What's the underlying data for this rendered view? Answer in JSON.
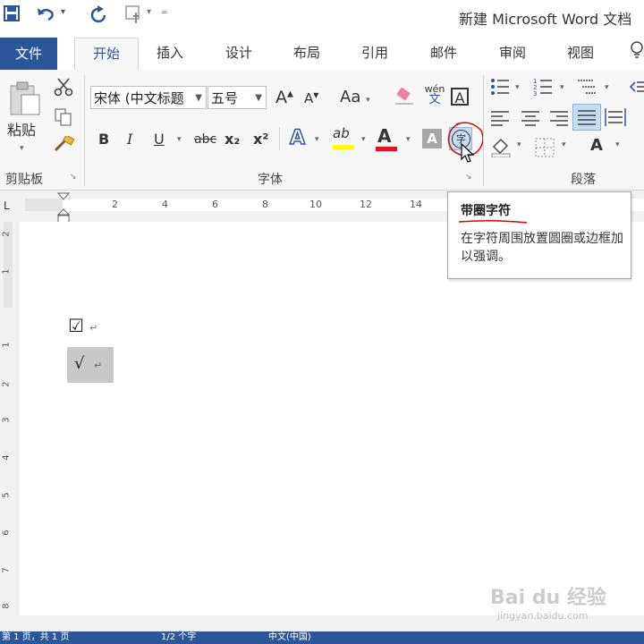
{
  "title_bar": {
    "save_icon": "save-icon",
    "undo_icon": "undo-icon",
    "redo_icon": "redo-icon",
    "touch_icon": "touch-mode-icon",
    "customize_icon": "customize-qat-icon",
    "title": "新建 Microsoft Word 文档"
  },
  "tabs": {
    "file": "文件",
    "home": "开始",
    "insert": "插入",
    "design": "设计",
    "layout": "布局",
    "references": "引用",
    "mailings": "邮件",
    "review": "审阅",
    "view": "视图"
  },
  "clipboard": {
    "paste": "粘贴",
    "group_label": "剪贴板"
  },
  "font": {
    "font_name": "宋体 (中文标题",
    "font_size": "五号",
    "grow": "A",
    "shrink": "A",
    "change_case": "Aa",
    "phonetic": "wén",
    "phonetic_char": "文",
    "border_char": "A",
    "bold": "B",
    "italic": "I",
    "underline": "U",
    "strikethrough": "abc",
    "subscript": "x₂",
    "superscript": "x²",
    "text_effects": "A",
    "highlight": "ab",
    "font_color": "A",
    "char_shading": "A",
    "enclose_char": "字",
    "group_label": "字体"
  },
  "paragraph": {
    "group_label": "段落",
    "sort": "A"
  },
  "colors": {
    "brand": "#2b579a",
    "font_color_bar": "#e81123",
    "highlight_bar": "#ffff00",
    "annotation_red": "#e00000"
  },
  "ruler": {
    "numbers": [
      "2",
      "4",
      "6",
      "8",
      "10",
      "12",
      "14"
    ],
    "vertical_numbers": [
      "2",
      "1",
      "1",
      "2",
      "3",
      "4",
      "5",
      "6",
      "7",
      "8"
    ]
  },
  "tooltip": {
    "title": "带圈字符",
    "description": "在字符周围放置圆圈或边框加以强调。"
  },
  "document": {
    "line1": "☑",
    "line2": "√",
    "para_mark": "↵"
  },
  "status_bar": {
    "page_info": "第 1 页，共 1 页",
    "words": "1/2 个字",
    "language": "中文(中国)"
  },
  "watermark": {
    "brand": "Bai du 经验",
    "url": "jingyan.baidu.com"
  }
}
